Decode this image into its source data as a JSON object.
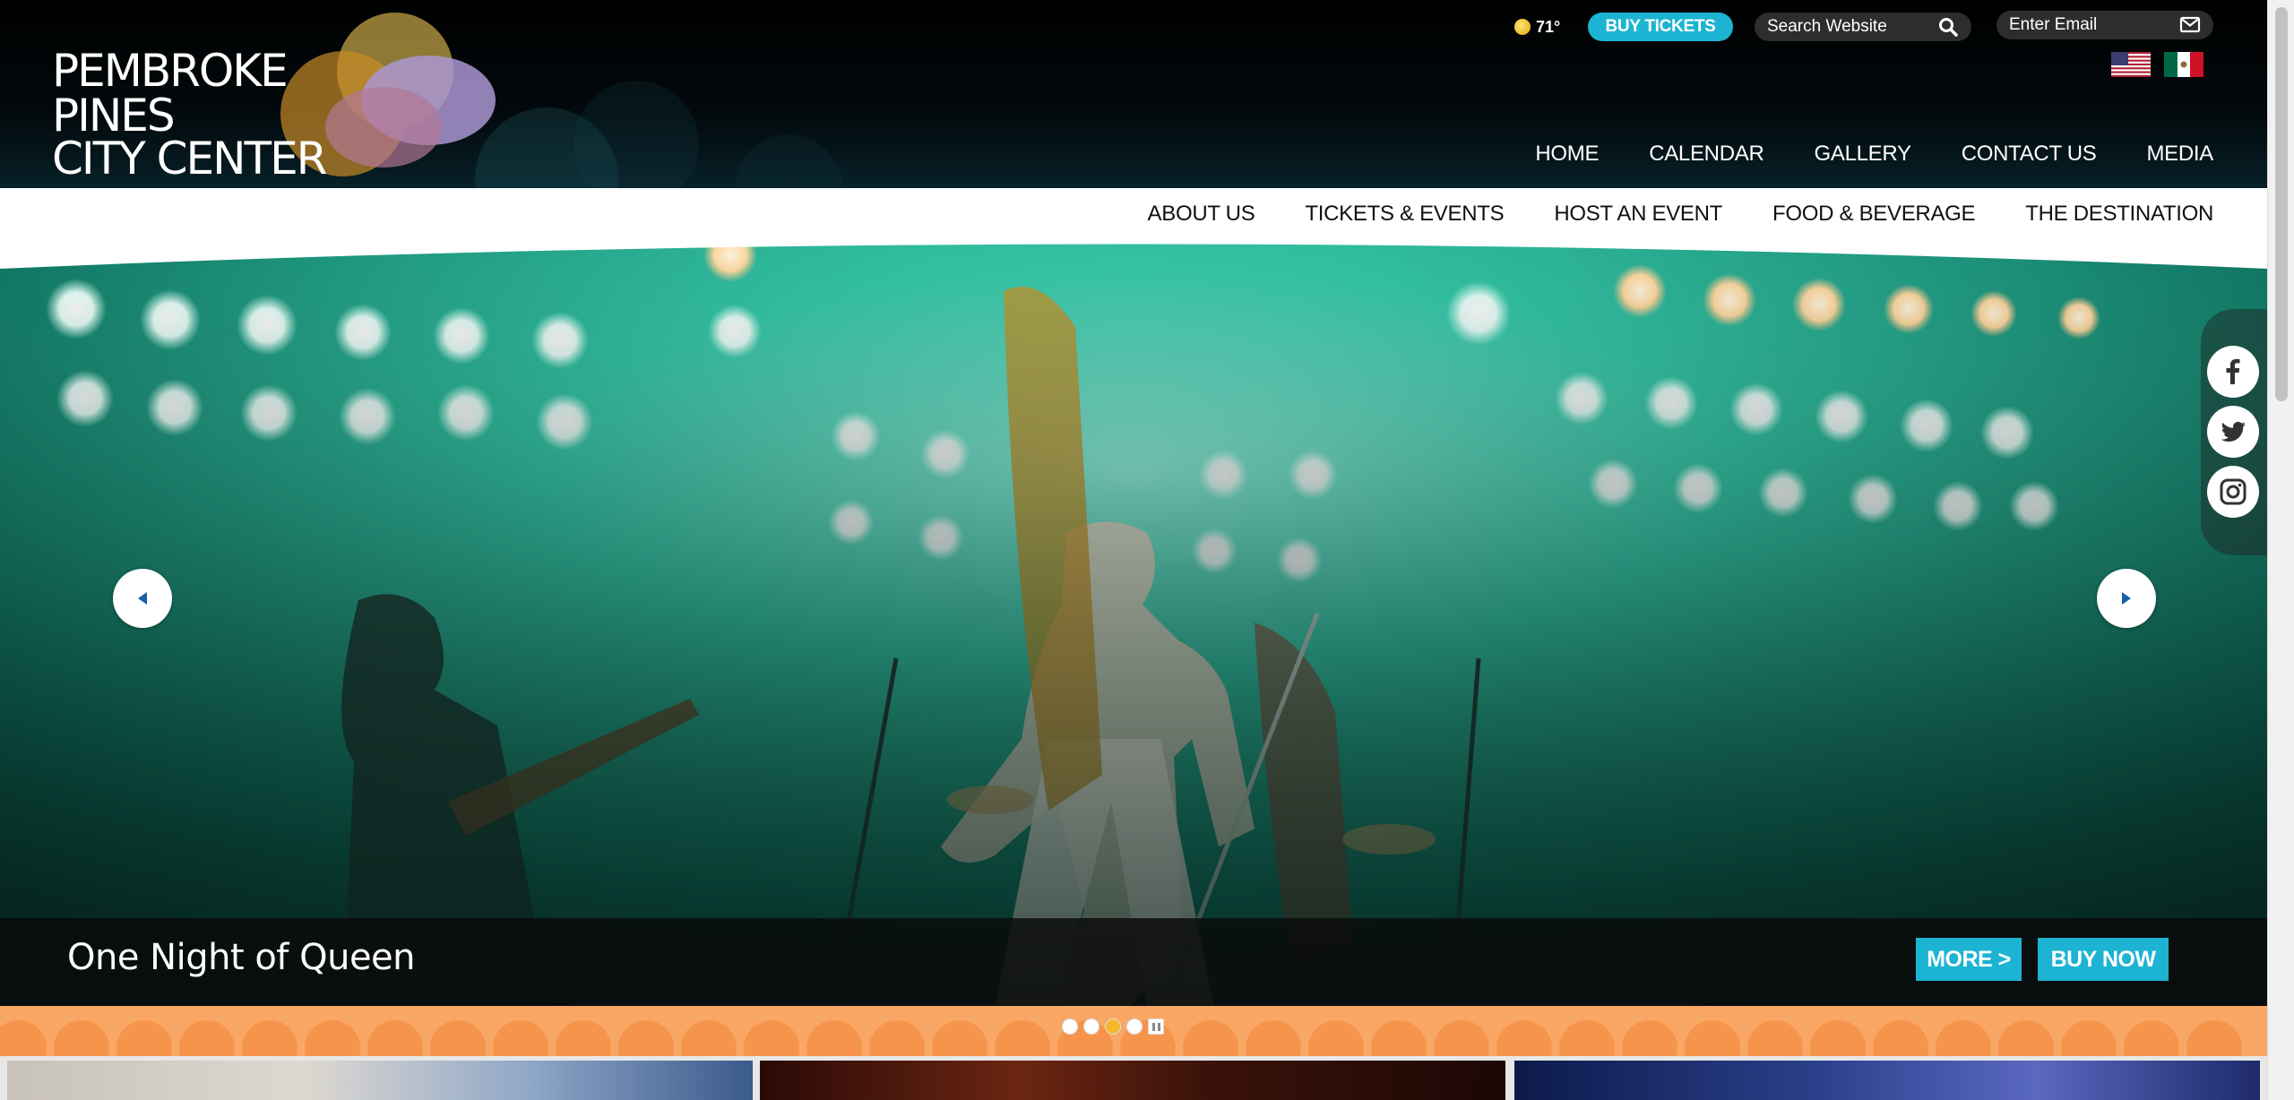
{
  "logo": {
    "line1": "PEMBROKE",
    "line2": "PINES",
    "line3": "CITY CENTER"
  },
  "utility": {
    "weather_temp": "71°",
    "buy_tickets_label": "BUY TICKETS",
    "search_placeholder": "Search Website",
    "email_placeholder": "Enter Email",
    "languages": [
      "English (US flag)",
      "Español (Mexico flag)"
    ]
  },
  "main_nav": [
    "HOME",
    "CALENDAR",
    "GALLERY",
    "CONTACT US",
    "MEDIA"
  ],
  "sub_nav": [
    "ABOUT US",
    "TICKETS & EVENTS",
    "HOST AN EVENT",
    "FOOD & BEVERAGE",
    "THE DESTINATION"
  ],
  "hero": {
    "caption": "One Night of Queen",
    "more_label": "MORE >",
    "buy_now_label": "BUY NOW",
    "slide_count": 4,
    "active_slide": 3
  },
  "social": [
    "facebook-icon",
    "twitter-icon",
    "instagram-icon"
  ],
  "colors": {
    "accent": "#1cb4d2",
    "orange_strip": "#f9a764",
    "header_bg": "#000000",
    "active_dot": "#f5b92d"
  }
}
